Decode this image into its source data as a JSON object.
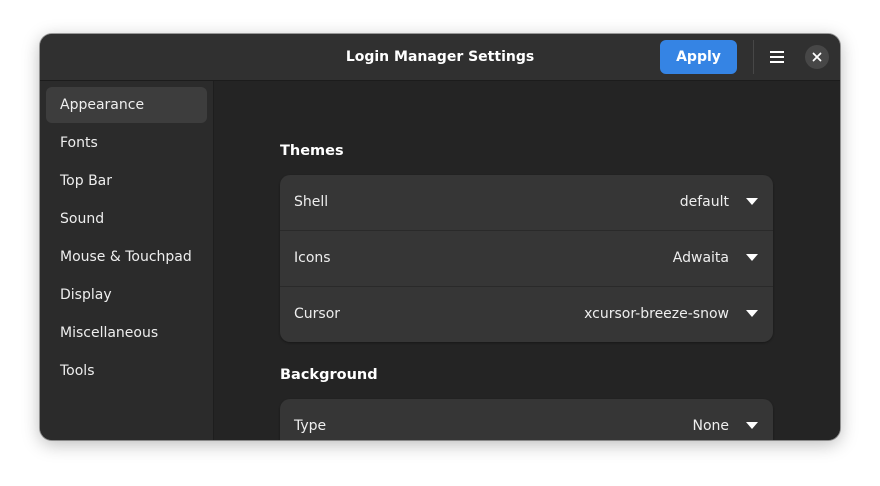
{
  "window": {
    "title": "Login Manager Settings",
    "apply_label": "Apply",
    "menu_icon": "hamburger-menu-icon",
    "close_icon": "close-icon"
  },
  "sidebar": {
    "items": [
      {
        "label": "Appearance",
        "active": true
      },
      {
        "label": "Fonts"
      },
      {
        "label": "Top Bar"
      },
      {
        "label": "Sound"
      },
      {
        "label": "Mouse & Touchpad"
      },
      {
        "label": "Display"
      },
      {
        "label": "Miscellaneous"
      },
      {
        "label": "Tools"
      }
    ]
  },
  "themes": {
    "title": "Themes",
    "rows": [
      {
        "label": "Shell",
        "value": "default"
      },
      {
        "label": "Icons",
        "value": "Adwaita"
      },
      {
        "label": "Cursor",
        "value": "xcursor-breeze-snow"
      }
    ]
  },
  "background": {
    "title": "Background",
    "rows": [
      {
        "label": "Type",
        "value": "None"
      }
    ]
  },
  "colors": {
    "accent": "#3584e4",
    "window_bg": "#242424",
    "sidebar_bg": "#2b2b2b",
    "card_bg": "#363636"
  }
}
